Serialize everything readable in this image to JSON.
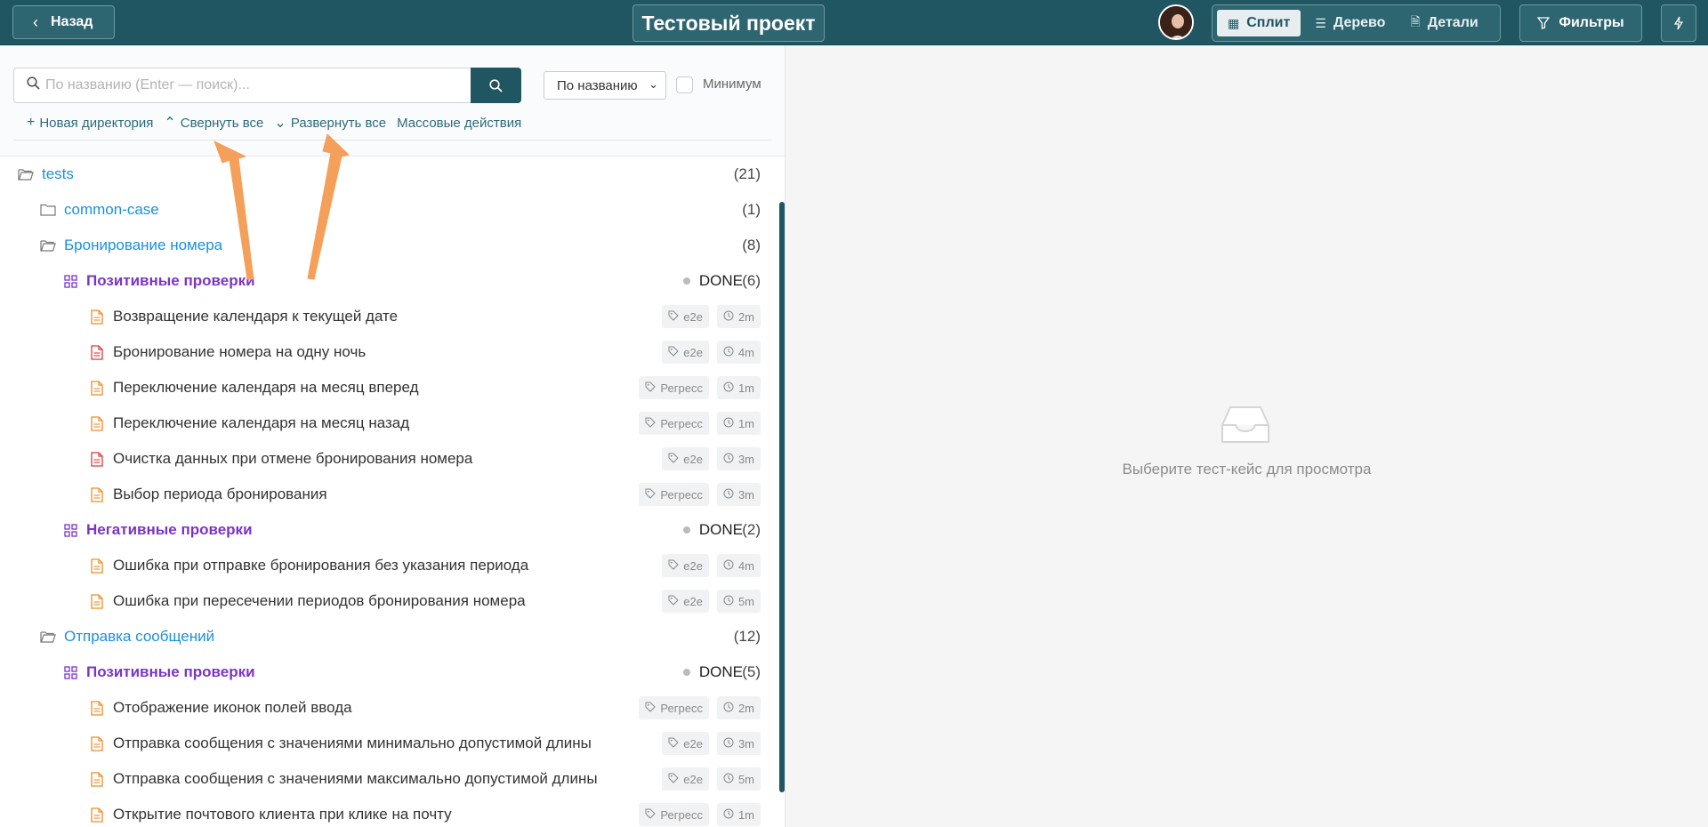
{
  "header": {
    "back_label": "Назад",
    "project_title": "Тестовый проект",
    "views": [
      {
        "label": "Сплит",
        "active": true
      },
      {
        "label": "Дерево",
        "active": false
      },
      {
        "label": "Детали",
        "active": false
      }
    ],
    "filters_label": "Фильтры"
  },
  "search": {
    "placeholder": "По названию (Enter — поиск)...",
    "sort_value": "По названию",
    "min_label": "Минимум"
  },
  "actions": [
    "Новая директория",
    "Свернуть все",
    "Развернуть все",
    "Массовые действия"
  ],
  "tree": {
    "root": {
      "name": "tests",
      "count": "(21)"
    },
    "dir1": {
      "name": "common-case",
      "count": "(1)"
    },
    "dir2": {
      "name": "Бронирование номера",
      "count": "(8)"
    },
    "suite1": {
      "name": "Позитивные проверки",
      "status": "DONE",
      "count": "(6)"
    },
    "cases1": [
      {
        "name": "Возвращение календаря к текущей дате",
        "tag": "e2e",
        "time": "2m",
        "color": "#f28c28"
      },
      {
        "name": "Бронирование номера на одну ночь",
        "tag": "e2e",
        "time": "4m",
        "color": "#e03a3a"
      },
      {
        "name": "Переключение календаря на месяц вперед",
        "tag": "Регресс",
        "time": "1m",
        "color": "#f28c28"
      },
      {
        "name": "Переключение календаря на месяц назад",
        "tag": "Регресс",
        "time": "1m",
        "color": "#f28c28"
      },
      {
        "name": "Очистка данных при отмене бронирования номера",
        "tag": "e2e",
        "time": "3m",
        "color": "#e03a3a"
      },
      {
        "name": "Выбор периода бронирования",
        "tag": "Регресс",
        "time": "3m",
        "color": "#f28c28"
      }
    ],
    "suite2": {
      "name": "Негативные проверки",
      "status": "DONE",
      "count": "(2)"
    },
    "cases2": [
      {
        "name": "Ошибка при отправке бронирования без указания периода",
        "tag": "e2e",
        "time": "4m",
        "color": "#f28c28"
      },
      {
        "name": "Ошибка при пересечении периодов бронирования номера",
        "tag": "e2e",
        "time": "5m",
        "color": "#f28c28"
      }
    ],
    "dir3": {
      "name": "Отправка сообщений",
      "count": "(12)"
    },
    "suite3": {
      "name": "Позитивные проверки",
      "status": "DONE",
      "count": "(5)"
    },
    "cases3": [
      {
        "name": "Отображение иконок полей ввода",
        "tag": "Регресс",
        "time": "2m",
        "color": "#f28c28"
      },
      {
        "name": "Отправка сообщения с значениями минимально допустимой длины",
        "tag": "e2e",
        "time": "3m",
        "color": "#f28c28"
      },
      {
        "name": "Отправка сообщения с значениями максимально допустимой длины",
        "tag": "e2e",
        "time": "5m",
        "color": "#f28c28"
      },
      {
        "name": "Открытие почтового клиента при клике на почту",
        "tag": "Регресс",
        "time": "1m",
        "color": "#f28c28"
      }
    ]
  },
  "empty_state": {
    "text": "Выберите тест-кейс для просмотра"
  }
}
